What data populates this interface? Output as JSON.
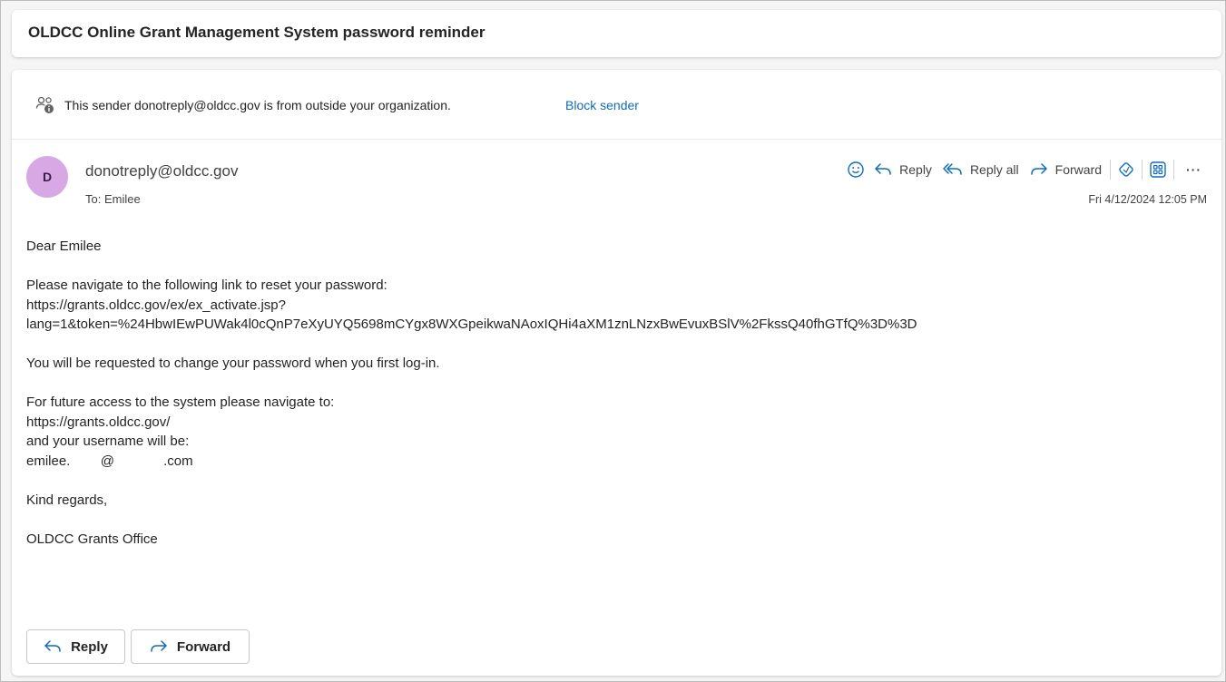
{
  "subject": "OLDCC Online Grant Management System password reminder",
  "warning": {
    "text": "This sender donotreply@oldcc.gov is from outside your organization.",
    "block_label": "Block sender"
  },
  "header": {
    "avatar_initial": "D",
    "sender": "donotreply@oldcc.gov",
    "to": "To:  Emilee",
    "date": "Fri 4/12/2024 12:05 PM"
  },
  "toolbar": {
    "reply_label": "Reply",
    "reply_all_label": "Reply all",
    "forward_label": "Forward",
    "more_label": "···"
  },
  "body": {
    "greeting": "Dear Emilee",
    "reset_intro": "Please navigate to the following link to reset your password:",
    "reset_link_1": "https://grants.oldcc.gov/ex/ex_activate.jsp?",
    "reset_link_2": "lang=1&token=%24HbwIEwPUWak4l0cQnP7eXyUYQ5698mCYgx8WXGpeikwaNAoxIQHi4aXM1znLNzxBwEvuxBSlV%2FkssQ40fhGTfQ%3D%3D",
    "change_note": "You will be requested to change your password when you first log-in.",
    "future_intro": "For future access to the system please navigate to:",
    "future_link": "https://grants.oldcc.gov/",
    "username_intro": "and your username will be:",
    "username": "emilee.        @             .com",
    "regards": "Kind regards,",
    "signature": "OLDCC Grants Office"
  },
  "footer": {
    "reply_label": "Reply",
    "forward_label": "Forward"
  },
  "colors": {
    "accent": "#0f6cbd",
    "avatar_bg": "#d7a8e3"
  }
}
